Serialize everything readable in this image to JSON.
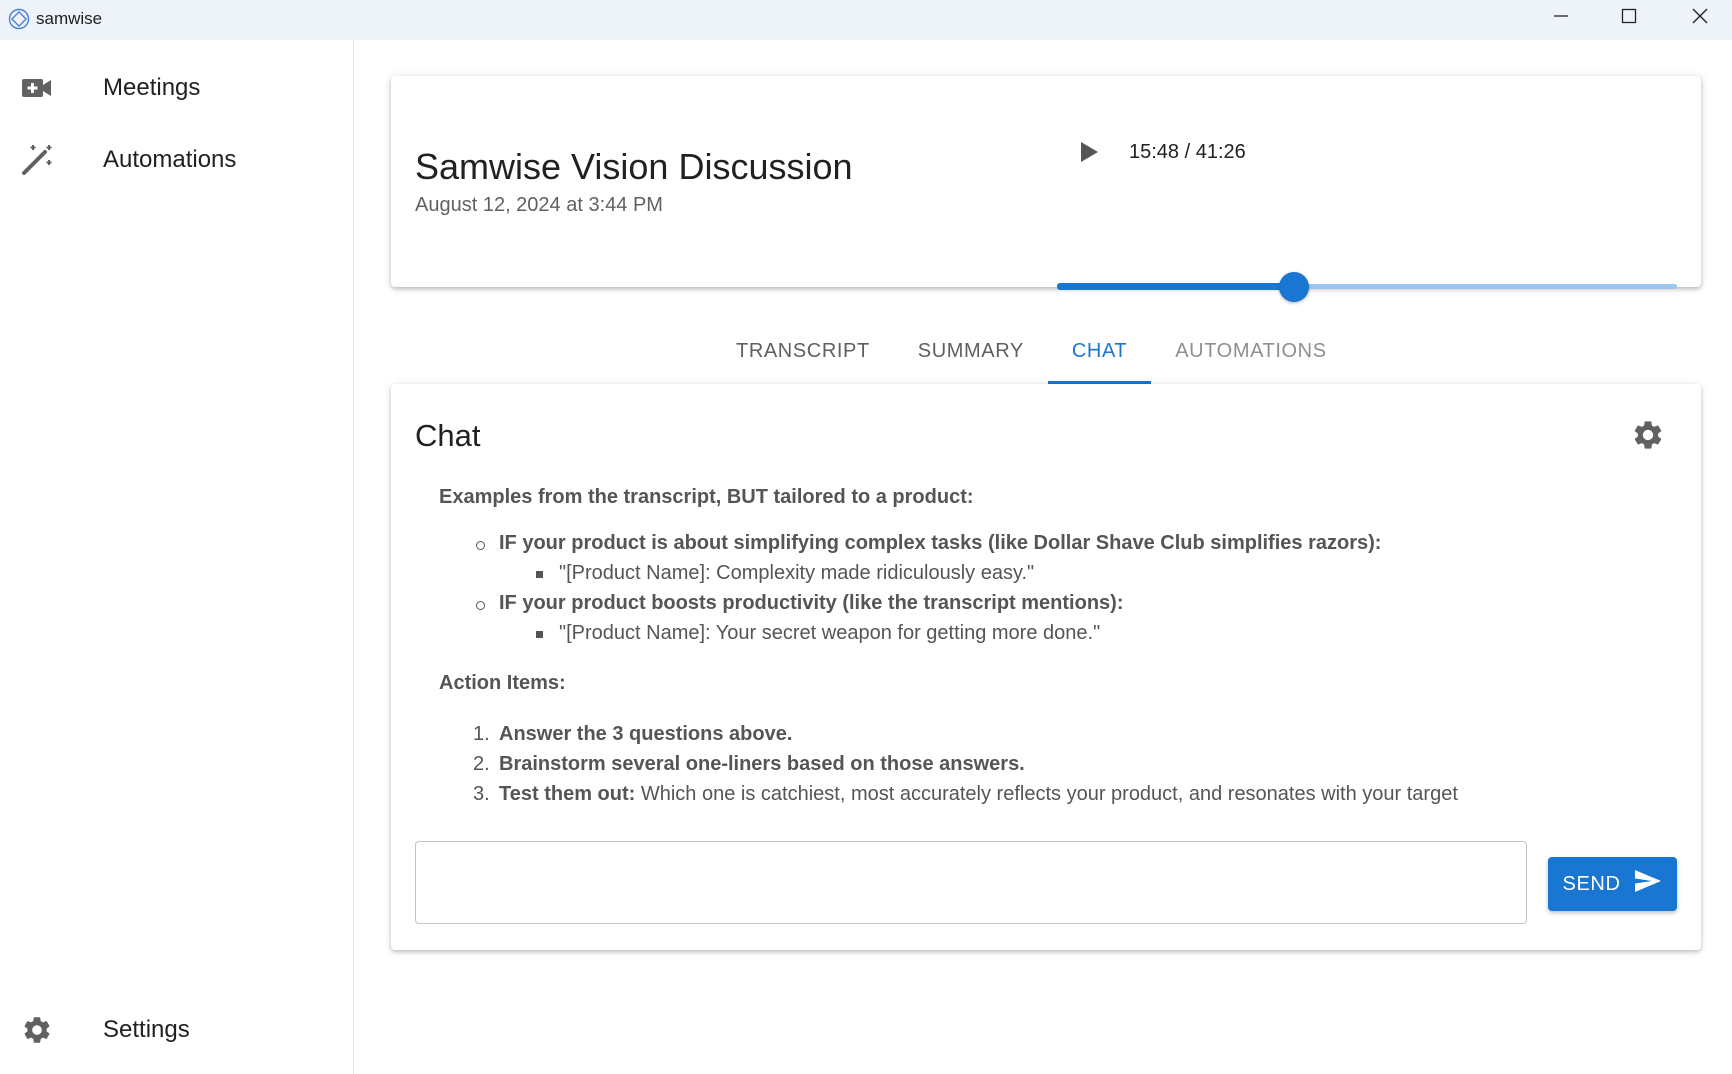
{
  "window": {
    "title": "samwise",
    "icon": "app-logo-icon",
    "controls": [
      "minimize-icon",
      "maximize-icon",
      "close-icon"
    ]
  },
  "sidebar": {
    "items": [
      {
        "label": "Meetings",
        "icon": "video-plus-icon"
      },
      {
        "label": "Automations",
        "icon": "magic-wand-icon"
      }
    ],
    "settings": {
      "label": "Settings",
      "icon": "gear-icon"
    }
  },
  "meeting": {
    "title": "Samwise Vision Discussion",
    "date": "August 12, 2024 at 3:44 PM",
    "player": {
      "time_text": "15:48 / 41:26",
      "progress_fraction": 0.382
    }
  },
  "tabs": [
    {
      "label": "TRANSCRIPT",
      "state": "normal"
    },
    {
      "label": "SUMMARY",
      "state": "normal"
    },
    {
      "label": "CHAT",
      "state": "active"
    },
    {
      "label": "AUTOMATIONS",
      "state": "disabled"
    }
  ],
  "chat": {
    "title": "Chat",
    "settings_icon": "gear-icon",
    "content": {
      "examples_heading": "Examples from the transcript, BUT tailored to a product:",
      "examples": [
        {
          "condition": "IF your product is about simplifying complex tasks (like Dollar Shave Club simplifies razors):",
          "example": "\"[Product Name]: Complexity made ridiculously easy.\""
        },
        {
          "condition": "IF your product boosts productivity (like the transcript mentions):",
          "example": "\"[Product Name]: Your secret weapon for getting more done.\""
        }
      ],
      "action_heading": "Action Items:",
      "action_items": [
        {
          "num": "1.",
          "bold": "Answer the 3 questions above.",
          "rest": ""
        },
        {
          "num": "2.",
          "bold": "Brainstorm several one-liners based on those answers.",
          "rest": ""
        },
        {
          "num": "3.",
          "bold": "Test them out:",
          "rest": " Which one is catchiest, most accurately reflects your product, and resonates with your target"
        }
      ]
    },
    "input": {
      "value": "",
      "placeholder": ""
    },
    "send_label": "SEND",
    "send_icon": "send-icon"
  },
  "colors": {
    "accent": "#1976d2",
    "slider_rail": "#9ec6ec",
    "titlebar_bg": "#eef3fa",
    "tab_muted": "#8f8f8f"
  }
}
